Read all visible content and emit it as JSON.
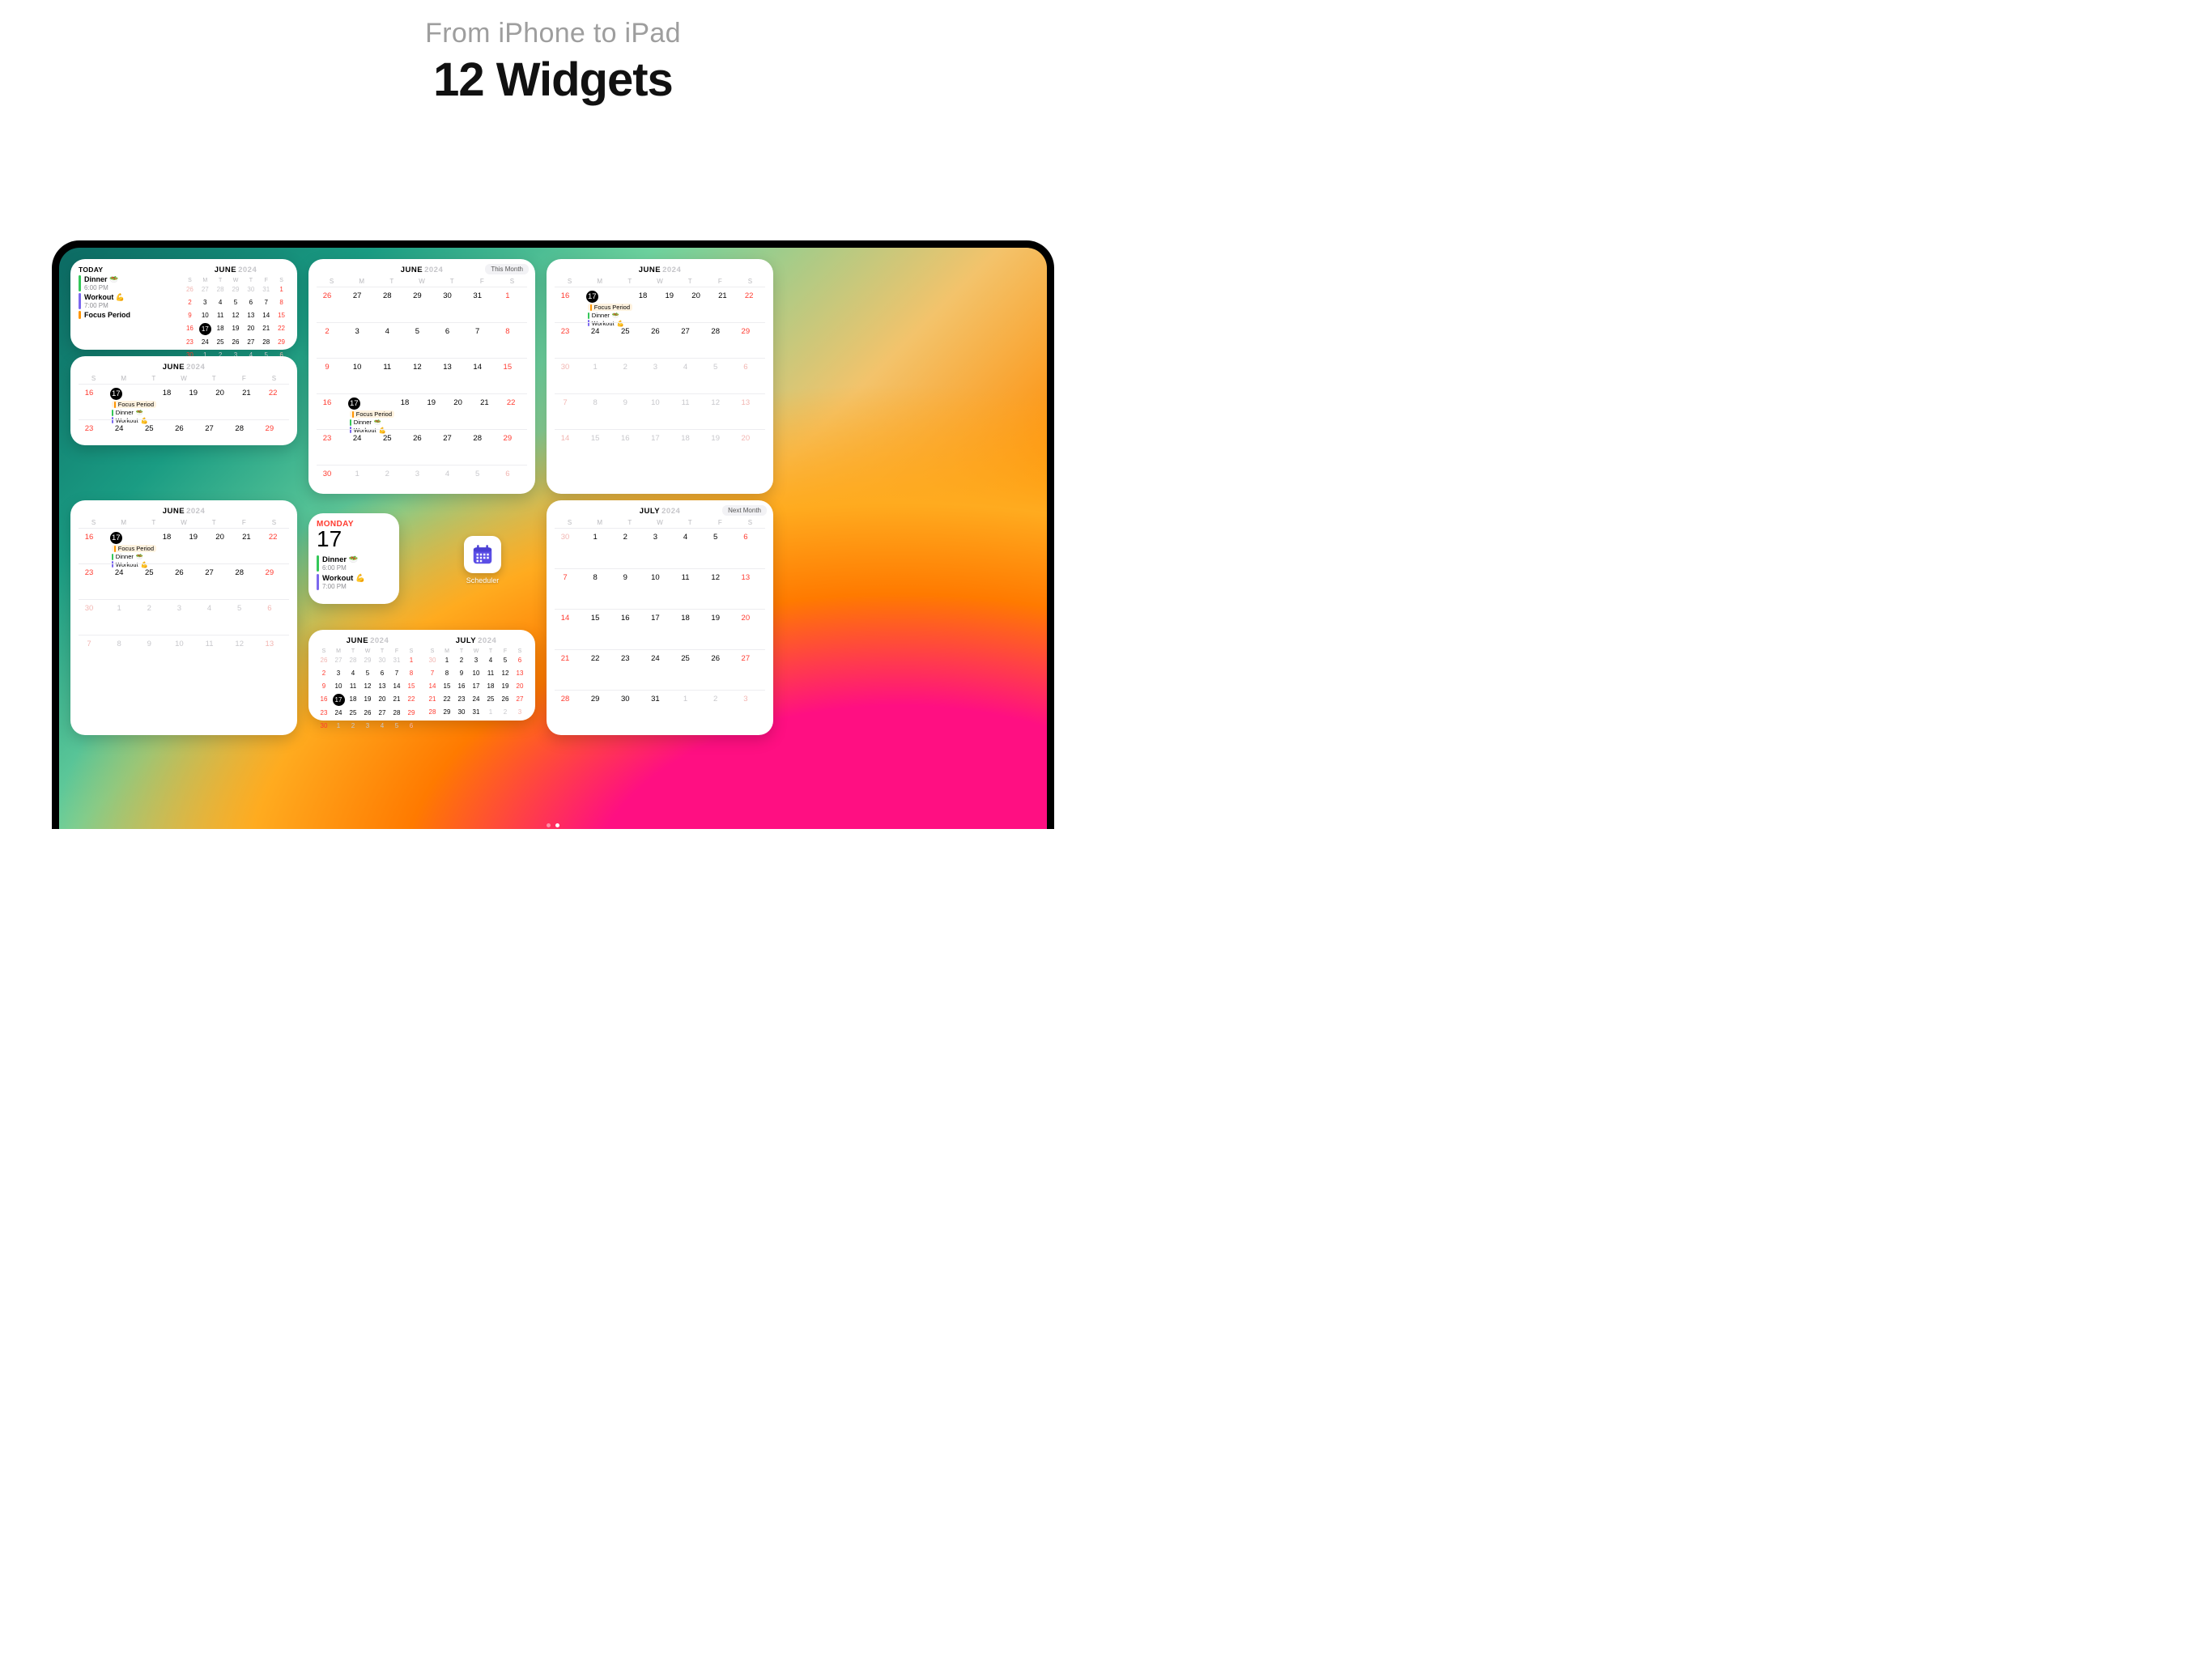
{
  "headings": {
    "sub": "From iPhone to iPad",
    "main": "12 Widgets"
  },
  "dow": [
    "S",
    "M",
    "T",
    "W",
    "T",
    "F",
    "S"
  ],
  "months": {
    "june": {
      "name": "JUNE",
      "year": "2024"
    },
    "july": {
      "name": "JULY",
      "year": "2024"
    }
  },
  "tags": {
    "this": "This Month",
    "next": "Next Month"
  },
  "today": {
    "label": "TODAY",
    "weekday": "MONDAY",
    "num": "17"
  },
  "events": {
    "dinner": {
      "name": "Dinner",
      "time": "6:00 PM",
      "emoji": "🥗"
    },
    "workout": {
      "name": "Workout",
      "time": "7:00 PM",
      "emoji": "💪"
    },
    "focus": {
      "name": "Focus Period"
    }
  },
  "app": {
    "label": "Scheduler"
  },
  "cal": {
    "june": [
      [
        26,
        27,
        28,
        29,
        30,
        31,
        1
      ],
      [
        2,
        3,
        4,
        5,
        6,
        7,
        8
      ],
      [
        9,
        10,
        11,
        12,
        13,
        14,
        15
      ],
      [
        16,
        17,
        18,
        19,
        20,
        21,
        22
      ],
      [
        23,
        24,
        25,
        26,
        27,
        28,
        29
      ],
      [
        30,
        1,
        2,
        3,
        4,
        5,
        6
      ]
    ],
    "july": [
      [
        30,
        1,
        2,
        3,
        4,
        5,
        6
      ],
      [
        7,
        8,
        9,
        10,
        11,
        12,
        13
      ],
      [
        14,
        15,
        16,
        17,
        18,
        19,
        20
      ],
      [
        21,
        22,
        23,
        24,
        25,
        26,
        27
      ],
      [
        28,
        29,
        30,
        31,
        1,
        2,
        3
      ]
    ]
  }
}
